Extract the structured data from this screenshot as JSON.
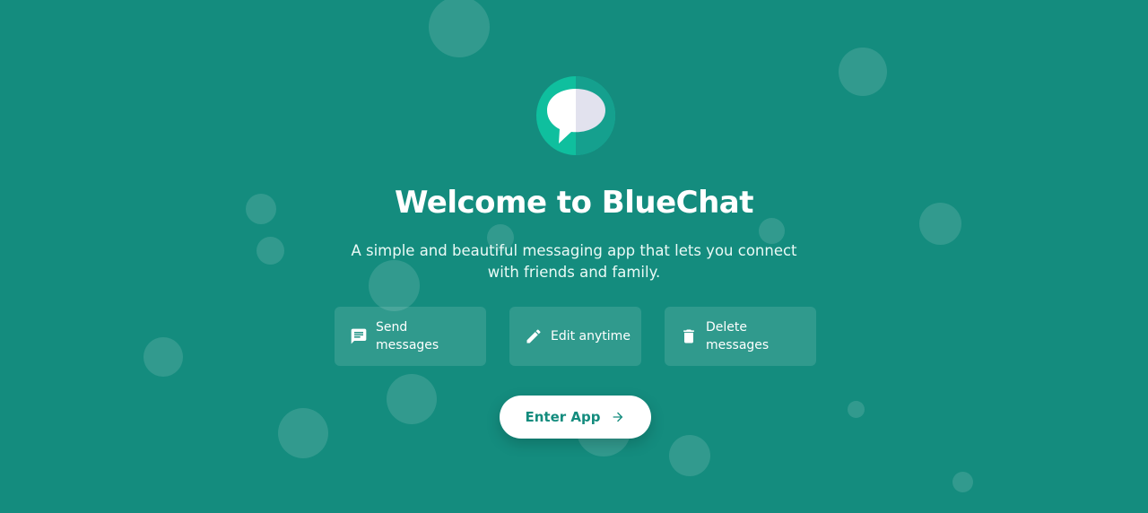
{
  "app": {
    "title": "Welcome to BlueChat",
    "subtitle": "A simple and beautiful messaging app that lets you connect with friends and family."
  },
  "features": [
    {
      "icon": "message-icon",
      "label": "Send messages"
    },
    {
      "icon": "pencil-icon",
      "label": "Edit anytime"
    },
    {
      "icon": "trash-icon",
      "label": "Delete messages"
    }
  ],
  "enter_button": {
    "label": "Enter App",
    "icon": "arrow-right-icon"
  },
  "colors": {
    "background": "#148c7e",
    "logo_circle": "#0fbf9e",
    "logo_shade": "#15a08e",
    "button_text": "#148c7e",
    "bubble_white": "#ffffff",
    "bubble_shade": "#e2e2ee"
  }
}
